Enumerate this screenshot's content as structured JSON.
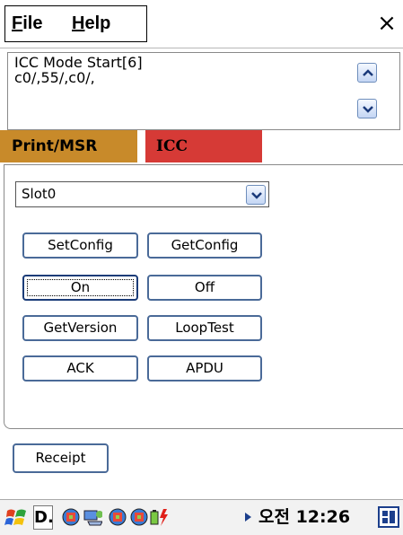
{
  "menu": {
    "file": "File",
    "help": "Help",
    "close": "×"
  },
  "log": {
    "text": "ICC Mode Start[6]\nc0/,55/,c0/,"
  },
  "tabs": [
    {
      "label": "Print/MSR"
    },
    {
      "label": "ICC"
    }
  ],
  "slot_select": {
    "value": "Slot0"
  },
  "buttons": {
    "set_config": "SetConfig",
    "get_config": "GetConfig",
    "on": "On",
    "off": "Off",
    "get_version": "GetVersion",
    "loop_test": "LoopTest",
    "ack": "ACK",
    "apdu": "APDU",
    "receipt": "Receipt"
  },
  "taskbar": {
    "task_label": "D.",
    "clock": "오전 12:26"
  },
  "colors": {
    "tab_print": "#c88a2a",
    "tab_icc": "#d63a36",
    "button_border": "#4a6a98"
  },
  "icons": [
    "windows-start-icon",
    "network-icon",
    "sync-icon",
    "network-icon",
    "network-icon",
    "battery-charging-icon",
    "tray-arrow-icon",
    "input-method-icon"
  ]
}
